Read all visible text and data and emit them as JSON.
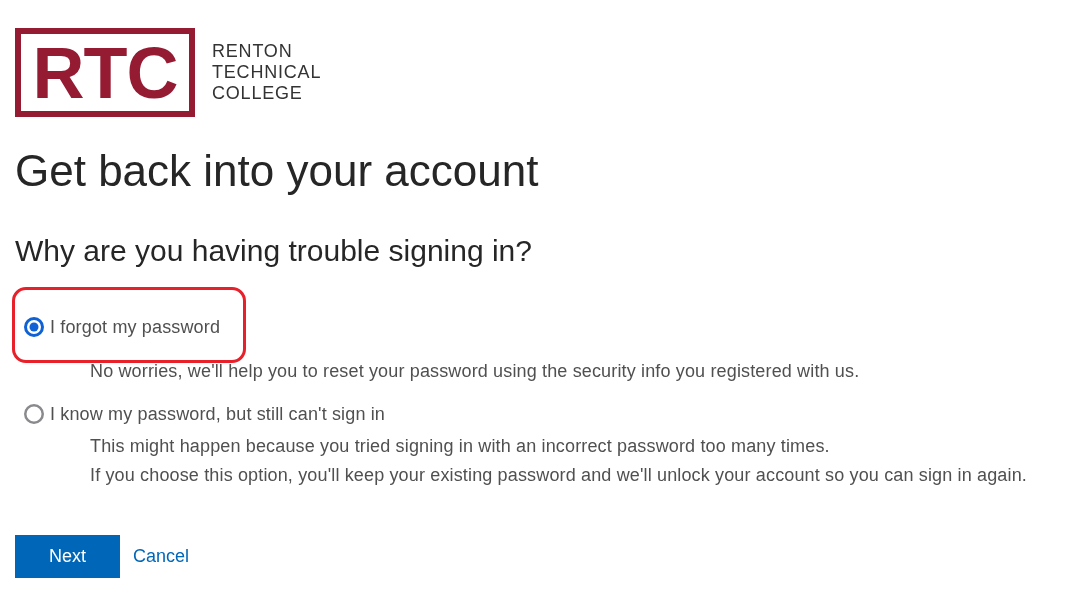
{
  "logo": {
    "mark": "RTC",
    "name_lines": [
      "RENTON",
      "TECHNICAL",
      "COLLEGE"
    ]
  },
  "title": "Get back into your account",
  "question": "Why are you having trouble signing in?",
  "options": [
    {
      "label": "I forgot my password",
      "selected": true,
      "highlighted": true,
      "description": [
        "No worries, we'll help you to reset your password using the security info you registered with us."
      ]
    },
    {
      "label": "I know my password, but still can't sign in",
      "selected": false,
      "highlighted": false,
      "description": [
        "This might happen because you tried signing in with an incorrect password too many times.",
        "If you choose this option, you'll keep your existing password and we'll unlock your account so you can sign in again."
      ]
    }
  ],
  "buttons": {
    "next": "Next",
    "cancel": "Cancel"
  }
}
